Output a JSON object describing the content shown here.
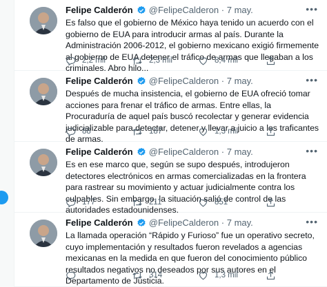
{
  "colors": {
    "accent": "#1d9bf0",
    "muted": "#536471",
    "text": "#0f1419",
    "divider": "#eff3f4"
  },
  "tweets": [
    {
      "name": "Felipe Calderón",
      "handle": "@FelipeCalderon",
      "dot": "·",
      "time": "7 may.",
      "text": "Es falso que el gobierno de México haya tenido un acuerdo con el gobierno de EUA para introducir armas al país. Durante la Administración 2006-2012, el gobierno mexicano exigió firmemente al gobierno de EUA detener el tráfico de armas que llegaban a los criminales. Abro hilo...",
      "replies": "2,2 mil",
      "retweets": "2,3 mil",
      "likes": "8,4 mil"
    },
    {
      "name": "Felipe Calderón",
      "handle": "@FelipeCalderon",
      "dot": "·",
      "time": "7 may.",
      "text": "Después de mucha insistencia, el gobierno de EUA ofreció tomar acciones para frenar el tráfico de armas. Entre ellas, la Procuraduría de aquel país buscó recolectar y generar evidencia judicializable para detectar, detener y llevar a juicio a los traficantes de armas.",
      "replies": "88",
      "retweets": "187",
      "likes": "1,3 mil"
    },
    {
      "name": "Felipe Calderón",
      "handle": "@FelipeCalderon",
      "dot": "·",
      "time": "7 may.",
      "text": "Es en ese marco que, según se supo después, introdujeron detectores electrónicos en armas comercializadas en la frontera para rastrear su movimiento y actuar judicialmente contra los culpables. Sin embargo, la situación salió de control de las autoridades estadounidenses.",
      "replies": "177",
      "retweets": "211",
      "likes": "851"
    },
    {
      "name": "Felipe Calderón",
      "handle": "@FelipeCalderon",
      "dot": "·",
      "time": "7 may.",
      "text": "La llamada operación “Rápido y Furioso” fue un operativo secreto, cuyo implementación y resultados fueron revelados a agencias mexicanas en la medida en que fueron del conocimiento público resultados negativos no deseados por sus autores en el Departamento de Justicia.",
      "replies": "",
      "retweets": "314",
      "likes": "1,3 mil"
    }
  ],
  "icons": {
    "verified": "verified-badge-icon",
    "more": "more-options-icon",
    "reply": "reply-icon",
    "retweet": "retweet-icon",
    "like": "heart-icon",
    "share": "share-icon"
  }
}
